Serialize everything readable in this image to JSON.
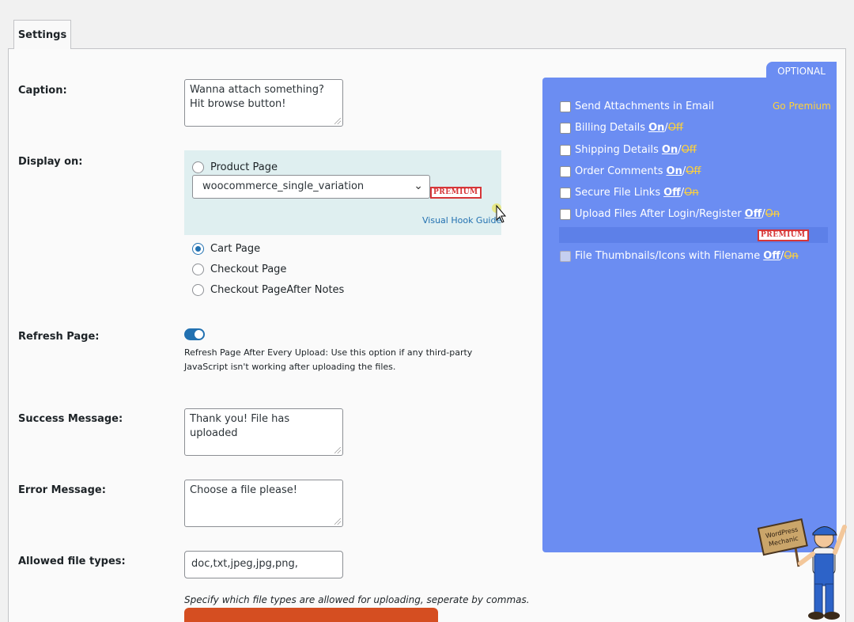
{
  "tabs": {
    "settings": "Settings"
  },
  "labels": {
    "caption": "Caption:",
    "display_on": "Display on:",
    "refresh": "Refresh Page:",
    "success": "Success Message:",
    "error": "Error Message:",
    "allowed": "Allowed file types:"
  },
  "caption_value": "Wanna attach something? Hit browse button!",
  "display": {
    "product_page": "Product Page",
    "hook_select": "woocommerce_single_variation",
    "premium": "PREMIUM",
    "visual_hook_guide": "Visual Hook Guide",
    "cart_page": "Cart Page",
    "checkout_page": "Checkout Page",
    "checkout_after_notes": "Checkout PageAfter Notes",
    "selected": "Cart Page"
  },
  "refresh": {
    "enabled": true,
    "description": "Refresh Page After Every Upload: Use this option if any third-party JavaScript isn't working after uploading the files."
  },
  "success_value": "Thank you! File has uploaded",
  "error_value": "Choose a file please!",
  "allowed_value": "doc,txt,jpeg,jpg,png,",
  "allowed_hint": "Specify which file types are allowed for uploading, seperate by commas.",
  "optional": {
    "tab": "OPTIONAL",
    "go_premium": "Go Premium",
    "premium": "PREMIUM",
    "items": [
      {
        "label": "Send Attachments in Email",
        "on": "",
        "off": ""
      },
      {
        "label": "Billing Details",
        "on": "On",
        "off": "Off"
      },
      {
        "label": "Shipping Details",
        "on": "On",
        "off": "Off"
      },
      {
        "label": "Order Comments",
        "on": "On",
        "off": "Off"
      },
      {
        "label": "Secure File Links",
        "on": "Off",
        "off": "On"
      },
      {
        "label": "Upload Files After Login/Register",
        "on": "Off",
        "off": "On"
      },
      {
        "label": "File Thumbnails/Icons with Filename",
        "on": "Off",
        "off": "On"
      }
    ]
  },
  "mascot": {
    "sign_line1": "WordPress",
    "sign_line2": "Mechanic"
  },
  "colors": {
    "accent": "#2271b1",
    "optional_panel": "#6b8df2",
    "premium_red": "#d63638",
    "highlight_yellow": "#ffd23a",
    "button_orange": "#d54e21"
  }
}
